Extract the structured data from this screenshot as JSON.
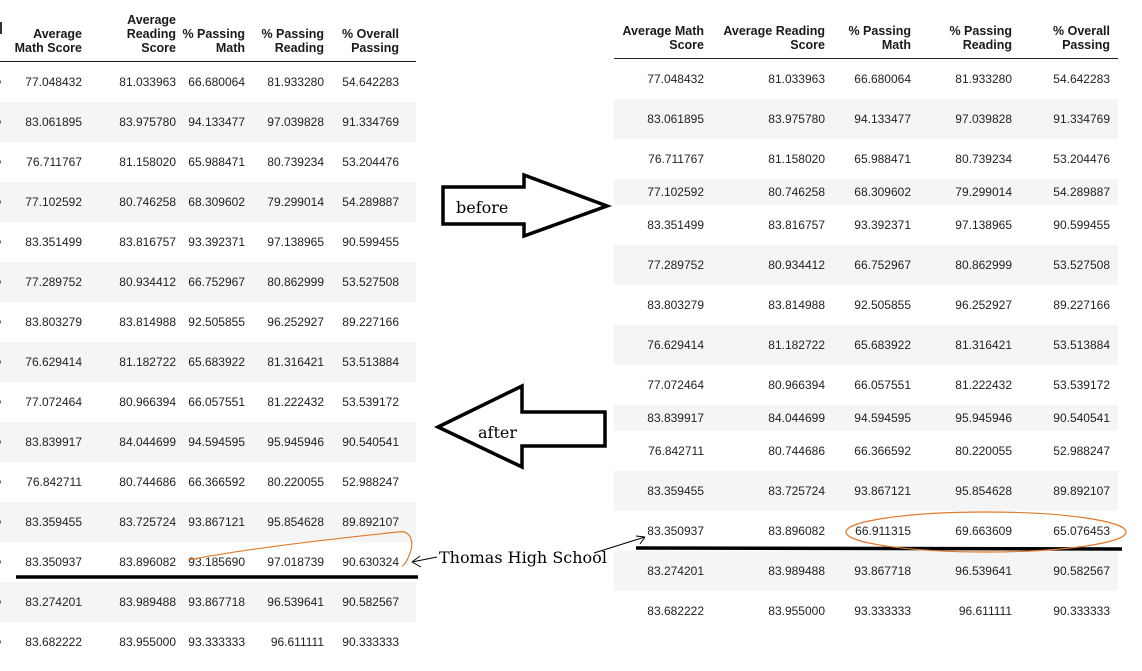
{
  "left_table": {
    "headers": [
      "Average Math Score",
      "Average Reading Score",
      "% Passing Math",
      "% Passing Reading",
      "% Overall Passing"
    ],
    "rows": [
      [
        "77.048432",
        "81.033963",
        "66.680064",
        "81.933280",
        "54.642283"
      ],
      [
        "83.061895",
        "83.975780",
        "94.133477",
        "97.039828",
        "91.334769"
      ],
      [
        "76.711767",
        "81.158020",
        "65.988471",
        "80.739234",
        "53.204476"
      ],
      [
        "77.102592",
        "80.746258",
        "68.309602",
        "79.299014",
        "54.289887"
      ],
      [
        "83.351499",
        "83.816757",
        "93.392371",
        "97.138965",
        "90.599455"
      ],
      [
        "77.289752",
        "80.934412",
        "66.752967",
        "80.862999",
        "53.527508"
      ],
      [
        "83.803279",
        "83.814988",
        "92.505855",
        "96.252927",
        "89.227166"
      ],
      [
        "76.629414",
        "81.182722",
        "65.683922",
        "81.316421",
        "53.513884"
      ],
      [
        "77.072464",
        "80.966394",
        "66.057551",
        "81.222432",
        "53.539172"
      ],
      [
        "83.839917",
        "84.044699",
        "94.594595",
        "95.945946",
        "90.540541"
      ],
      [
        "76.842711",
        "80.744686",
        "66.366592",
        "80.220055",
        "52.988247"
      ],
      [
        "83.359455",
        "83.725724",
        "93.867121",
        "95.854628",
        "89.892107"
      ],
      [
        "83.350937",
        "83.896082",
        "93.185690",
        "97.018739",
        "90.630324"
      ],
      [
        "83.274201",
        "83.989488",
        "93.867718",
        "96.539641",
        "90.582567"
      ],
      [
        "83.682222",
        "83.955000",
        "93.333333",
        "96.611111",
        "90.333333"
      ]
    ]
  },
  "right_table": {
    "headers": [
      "Average Math Score",
      "Average Reading Score",
      "% Passing Math",
      "% Passing Reading",
      "% Overall Passing"
    ],
    "rows": [
      [
        "77.048432",
        "81.033963",
        "66.680064",
        "81.933280",
        "54.642283"
      ],
      [
        "83.061895",
        "83.975780",
        "94.133477",
        "97.039828",
        "91.334769"
      ],
      [
        "76.711767",
        "81.158020",
        "65.988471",
        "80.739234",
        "53.204476"
      ],
      [
        "77.102592",
        "80.746258",
        "68.309602",
        "79.299014",
        "54.289887"
      ],
      [
        "83.351499",
        "83.816757",
        "93.392371",
        "97.138965",
        "90.599455"
      ],
      [
        "77.289752",
        "80.934412",
        "66.752967",
        "80.862999",
        "53.527508"
      ],
      [
        "83.803279",
        "83.814988",
        "92.505855",
        "96.252927",
        "89.227166"
      ],
      [
        "76.629414",
        "81.182722",
        "65.683922",
        "81.316421",
        "53.513884"
      ],
      [
        "77.072464",
        "80.966394",
        "66.057551",
        "81.222432",
        "53.539172"
      ],
      [
        "83.839917",
        "84.044699",
        "94.594595",
        "95.945946",
        "90.540541"
      ],
      [
        "76.842711",
        "80.744686",
        "66.366592",
        "80.220055",
        "52.988247"
      ],
      [
        "83.359455",
        "83.725724",
        "93.867121",
        "95.854628",
        "89.892107"
      ],
      [
        "83.350937",
        "83.896082",
        "66.911315",
        "69.663609",
        "65.076453"
      ],
      [
        "83.274201",
        "83.989488",
        "93.867718",
        "96.539641",
        "90.582567"
      ],
      [
        "83.682222",
        "83.955000",
        "93.333333",
        "96.611111",
        "90.333333"
      ]
    ]
  },
  "annotations": {
    "before_label": "before",
    "after_label": "after",
    "school_label": "Thomas High School"
  },
  "colors": {
    "highlight_ink": "#e07a2e",
    "row_stripe": "#f5f5f5",
    "index_marker": "#2c5ea8"
  }
}
